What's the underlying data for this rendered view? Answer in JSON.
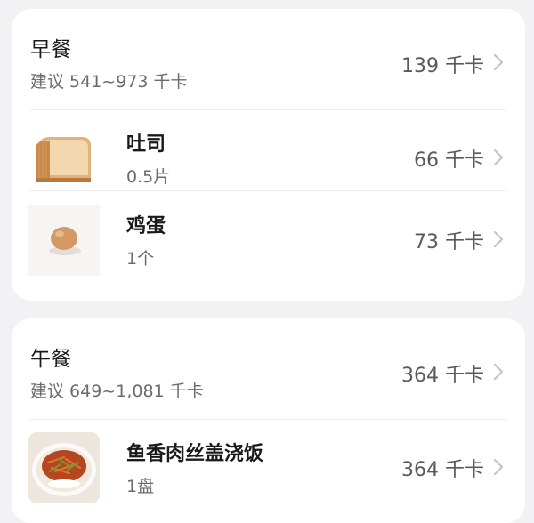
{
  "breakfast": {
    "title": "早餐",
    "suggestion": "建议 541~973 千卡",
    "kcal": "139 千卡",
    "items": [
      {
        "name": "吐司",
        "quantity": "0.5片",
        "kcal": "66 千卡",
        "icon": "toast-image"
      },
      {
        "name": "鸡蛋",
        "quantity": "1个",
        "kcal": "73 千卡",
        "icon": "egg-image"
      }
    ]
  },
  "lunch": {
    "title": "午餐",
    "suggestion": "建议 649~1,081 千卡",
    "kcal": "364 千卡",
    "items": [
      {
        "name": "鱼香肉丝盖浇饭",
        "quantity": "1盘",
        "kcal": "364 千卡",
        "icon": "rice-dish-image"
      }
    ]
  },
  "colors": {
    "card": "#ffffff",
    "background": "#f2f2f4",
    "secondary_text": "#6b6b6b"
  }
}
